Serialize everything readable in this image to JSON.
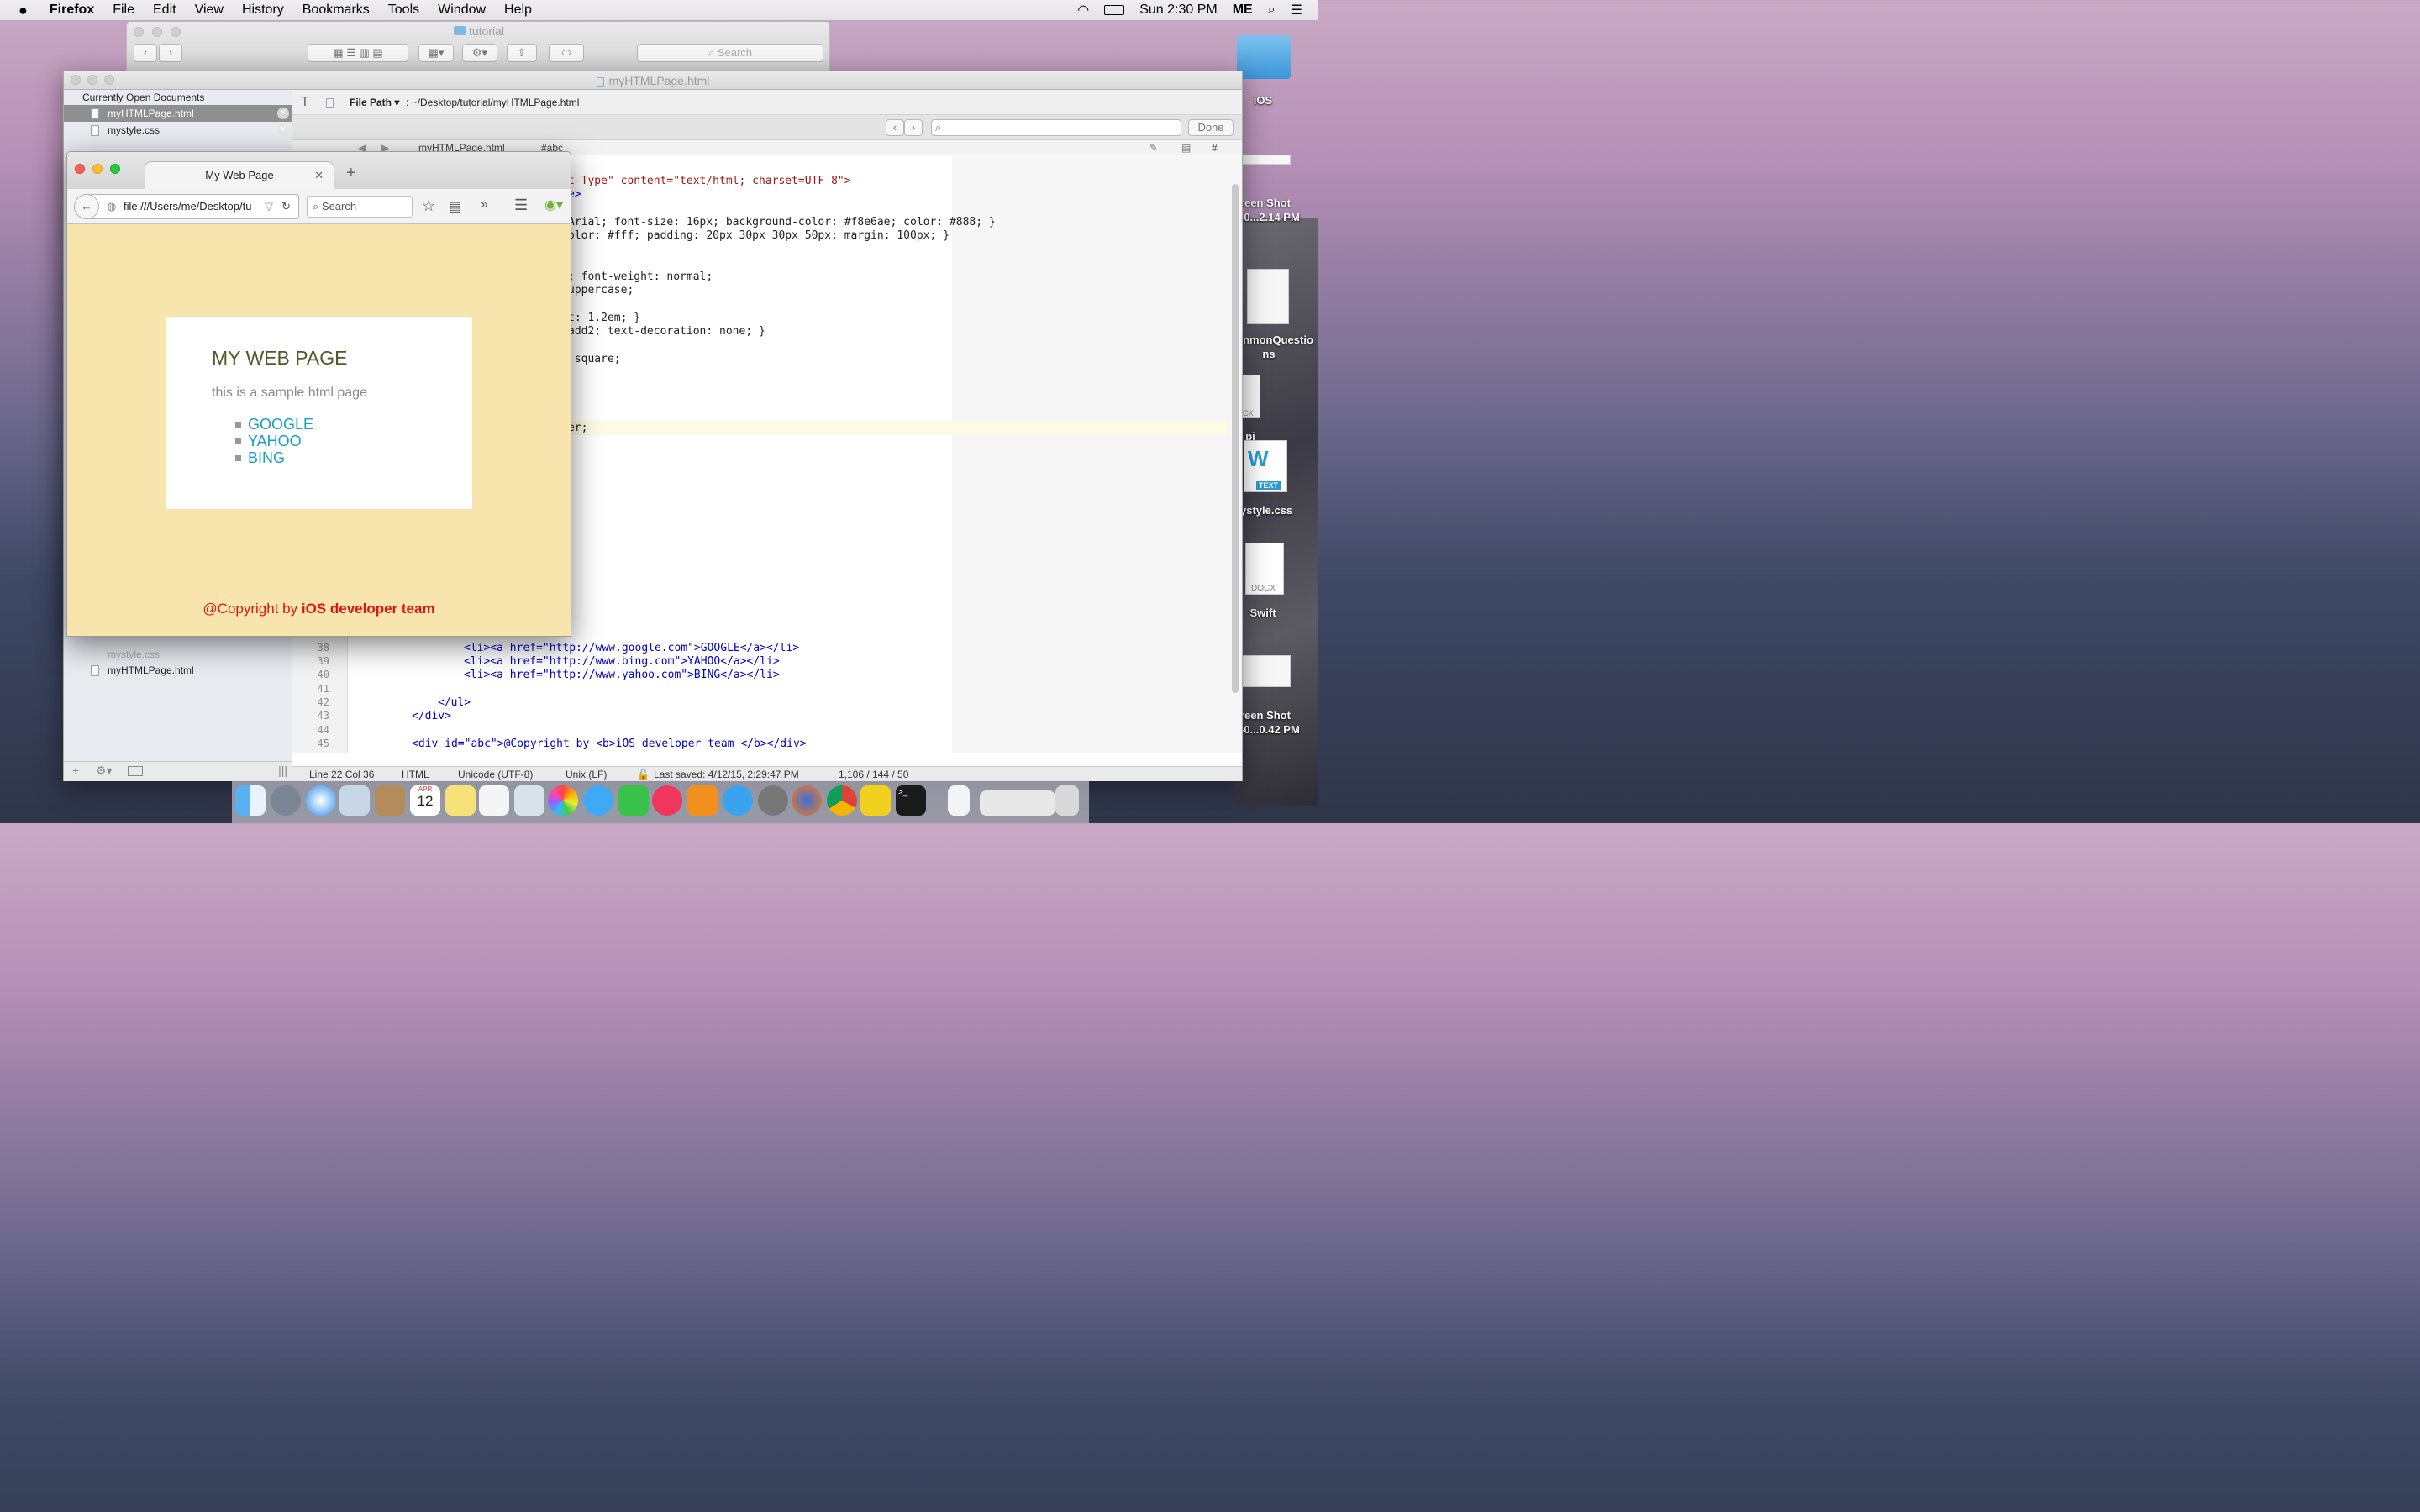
{
  "menubar": {
    "app": "Firefox",
    "menus": [
      "File",
      "Edit",
      "View",
      "History",
      "Bookmarks",
      "Tools",
      "Window",
      "Help"
    ],
    "clock": "Sun 2:30 PM",
    "user": "ME"
  },
  "finder": {
    "title": "tutorial",
    "search_placeholder": "Search"
  },
  "editor": {
    "title": "myHTMLPage.html",
    "sidebar": {
      "header": "Currently Open Documents",
      "items": [
        "myHTMLPage.html",
        "mystyle.css"
      ],
      "lower_items": [
        "mystyle.css",
        "myHTMLPage.html"
      ]
    },
    "path_label": "File Path",
    "path_value": ": ~/Desktop/tutorial/myHTMLPage.html",
    "find_done": "Done",
    "nav": {
      "file": "myHTMLPage.html",
      "symbol": "#abc",
      "hash": "#"
    },
    "code_top": [
      {
        "line": "t-Type\" content=\"text/html; charset=UTF-8\">"
      },
      {
        "line": "e>"
      },
      {
        "line": "Arial; font-size: 16px; background-color: #f8e6ae; color: #888; }"
      },
      {
        "line": "olor: #fff; padding: 20px 30px 30px 50px; margin: 100px; }"
      },
      {
        "line": "; font-weight: normal;"
      },
      {
        "line": "uppercase;"
      },
      {
        "line": "t: 1.2em; }"
      },
      {
        "line": "add2; text-decoration: none; }"
      },
      {
        "line": " square;"
      },
      {
        "line": "er;"
      }
    ],
    "code_bottom": [
      {
        "num": "38",
        "line": "<li><a href=\"http://www.google.com\">GOOGLE</a></li>"
      },
      {
        "num": "39",
        "line": "<li><a href=\"http://www.bing.com\">YAHOO</a></li>"
      },
      {
        "num": "40",
        "line": "<li><a href=\"http://www.yahoo.com\">BING</a></li>"
      },
      {
        "num": "41",
        "line": ""
      },
      {
        "num": "42",
        "line": "</ul>"
      },
      {
        "num": "43",
        "line": "</div>"
      },
      {
        "num": "44",
        "line": ""
      },
      {
        "num": "45",
        "line": "<div id=\"abc\">@Copyright by <b>iOS developer team </b></div>"
      }
    ],
    "status": {
      "position": "Line 22 Col 36",
      "syntax": "HTML",
      "encoding": "Unicode (UTF-8)",
      "line_endings": "Unix (LF)",
      "saved": "Last saved: 4/12/15, 2:29:47 PM",
      "counts": "1,106 / 144 / 50"
    }
  },
  "firefox": {
    "tab_title": "My Web Page",
    "url": "file:///Users/me/Desktop/tu",
    "search_placeholder": "Search",
    "page": {
      "title": "MY WEB PAGE",
      "subtitle": "this is a sample html page",
      "links": [
        "GOOGLE",
        "YAHOO",
        "BING"
      ],
      "copyright_prefix": "@Copyright by ",
      "copyright_bold": "iOS developer team"
    }
  },
  "desktop": {
    "icons": [
      "iOS",
      "reen Shot",
      "-0...2.14 PM",
      "nmonQuestio",
      "ns",
      "pi",
      "ystyle.css",
      "Swift",
      "reen Shot",
      "-0...0.42 PM"
    ],
    "thumb_labels": [
      "TEXT",
      "DOCX",
      "CX"
    ]
  },
  "dock": {
    "calendar_month": "APR",
    "calendar_day": "12"
  },
  "colors": {
    "page_bg": "#f8e6ae",
    "link": "#18a0c2",
    "copyright": "#e01414",
    "title": "#4e5a2a"
  }
}
